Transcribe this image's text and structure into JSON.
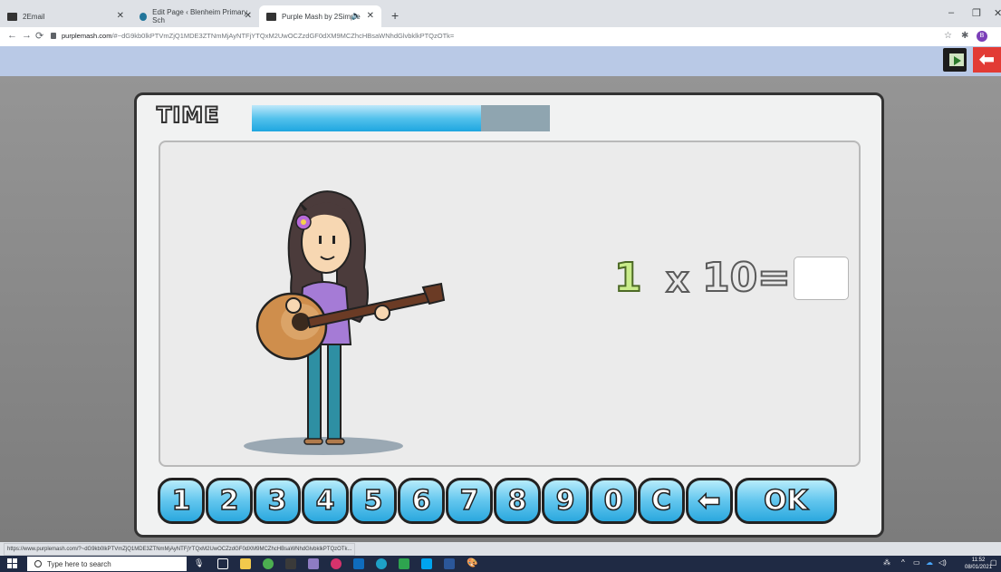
{
  "browser": {
    "tabs": [
      {
        "title": "2Email",
        "active": false
      },
      {
        "title": "Edit Page ‹ Blenheim Primary Sch",
        "active": false
      },
      {
        "title": "Purple Mash by 2Simple",
        "active": true
      }
    ],
    "url_host": "purplemash.com",
    "url_path": "/#~dG9kb0lkPTVmZjQ1MDE3ZTNmMjAyNTFjYTQxM2UwOCZzdGF0dXM9MCZhcHBsaWNhdGlvbklkPTQzOTk=",
    "profile_initial": "B",
    "status_url": "https://www.purplemash.com/?~dG9kb0lkPTVmZjQ1MDE3ZTNmMjAyNTFjYTQxM2UwOCZzdGF0dXM9MCZhcHBsaWNhdGlvbklkPTQzOTk..."
  },
  "game": {
    "time_label": "TIME",
    "time_remaining_fraction": 0.77,
    "equation": {
      "left": "1",
      "operator": "x",
      "right": "10",
      "equals": "="
    },
    "answer": "",
    "keys": [
      "1",
      "2",
      "3",
      "4",
      "5",
      "6",
      "7",
      "8",
      "9",
      "0",
      "C",
      "⬅",
      "OK"
    ]
  },
  "taskbar": {
    "search_placeholder": "Type here to search",
    "time": "11:52",
    "date": "08/01/2021"
  },
  "colors": {
    "app_header": "#b9c9e6",
    "key_blue": "#62c6ee",
    "back_red": "#e23b35"
  }
}
